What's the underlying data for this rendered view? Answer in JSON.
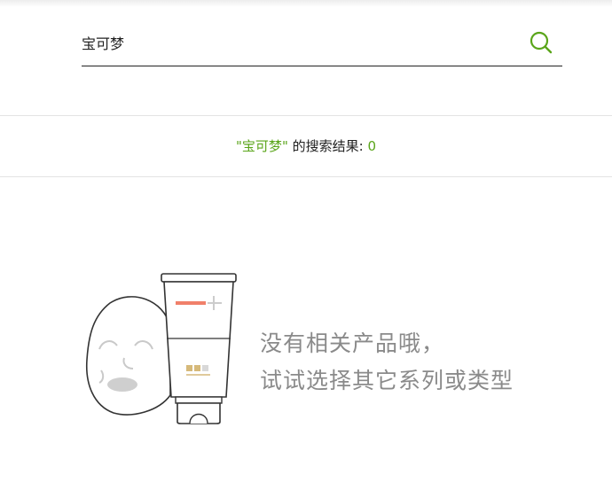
{
  "search": {
    "value": "宝可梦",
    "icon": "search-icon"
  },
  "results": {
    "open_quote": "\"",
    "keyword": "宝可梦",
    "close_quote": "\"",
    "label": " 的搜索结果: ",
    "count": "0"
  },
  "empty_state": {
    "line1": "没有相关产品哦，",
    "line2": "试试选择其它系列或类型"
  },
  "colors": {
    "accent": "#5aa51a",
    "muted_text": "#8a8a8a",
    "tube_stripe": "#f0806a",
    "tube_swatch": "#d6b97a"
  }
}
